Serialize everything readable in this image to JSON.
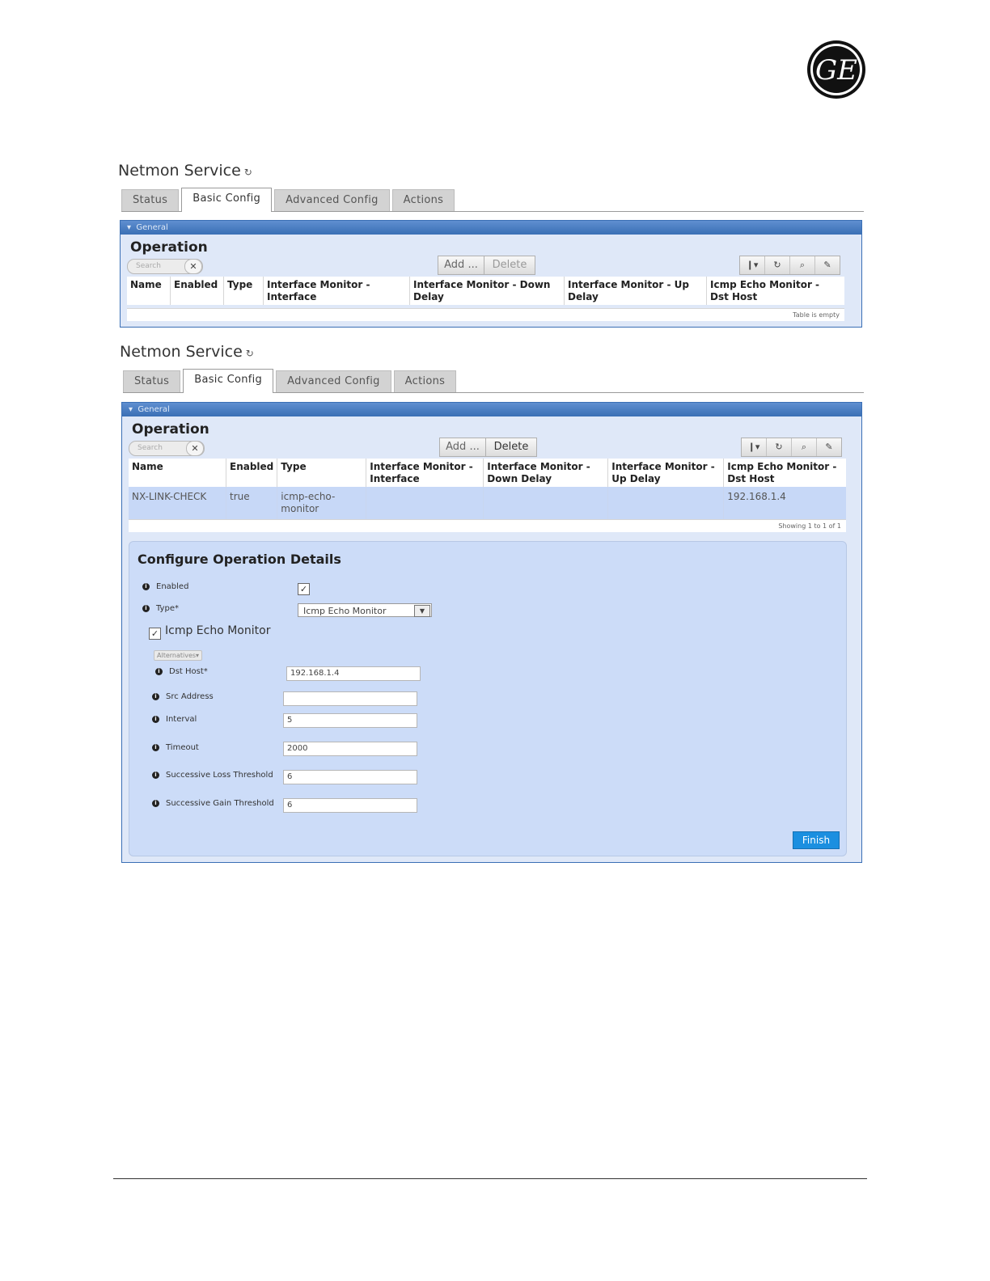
{
  "logo": {
    "text": "GE"
  },
  "screens": [
    {
      "title": "Netmon Service",
      "tabs": [
        "Status",
        "Basic Config",
        "Advanced Config",
        "Actions"
      ],
      "active_tab": "Basic Config",
      "panel_header": "General",
      "section_title": "Operation",
      "search_placeholder": "Search",
      "add_label": "Add ...",
      "delete_label": "Delete",
      "columns": [
        "Name",
        "Enabled",
        "Type",
        "Interface Monitor - Interface",
        "Interface Monitor - Down Delay",
        "Interface Monitor - Up Delay",
        "Icmp Echo Monitor - Dst Host"
      ],
      "rows": [],
      "footer": "Table is empty"
    },
    {
      "title": "Netmon Service",
      "tabs": [
        "Status",
        "Basic Config",
        "Advanced Config",
        "Actions"
      ],
      "active_tab": "Basic Config",
      "panel_header": "General",
      "section_title": "Operation",
      "search_placeholder": "Search",
      "add_label": "Add ...",
      "delete_label": "Delete",
      "columns": [
        "Name",
        "Enabled",
        "Type",
        "Interface Monitor - Interface",
        "Interface Monitor - Down Delay",
        "Interface Monitor - Up Delay",
        "Icmp Echo Monitor - Dst Host"
      ],
      "rows": [
        [
          "NX-LINK-CHECK",
          "true",
          "icmp-echo-monitor",
          "",
          "",
          "",
          "192.168.1.4"
        ]
      ],
      "footer": "Showing 1 to 1 of 1"
    }
  ],
  "configure": {
    "title": "Configure Operation Details",
    "enabled_label": "Enabled",
    "enabled_checked": true,
    "type_label": "Type*",
    "type_value": "Icmp Echo Monitor",
    "group_label": "Icmp Echo Monitor",
    "group_checked": true,
    "alternatives_label": "Alternatives▾",
    "fields": [
      {
        "label": "Dst Host*",
        "value": "192.168.1.4"
      },
      {
        "label": "Src Address",
        "value": ""
      },
      {
        "label": "Interval",
        "value": "5"
      },
      {
        "label": "Timeout",
        "value": "2000"
      },
      {
        "label": "Successive Loss Threshold",
        "value": "6"
      },
      {
        "label": "Successive Gain Threshold",
        "value": "6"
      }
    ],
    "finish_label": "Finish"
  },
  "icons": {
    "refresh": "↻",
    "info": "i",
    "close": "✕",
    "columns": "❙▾",
    "search": "⌕",
    "wrench": "✎",
    "dropdown": "▼",
    "check": "✓",
    "collapse": "▾"
  }
}
